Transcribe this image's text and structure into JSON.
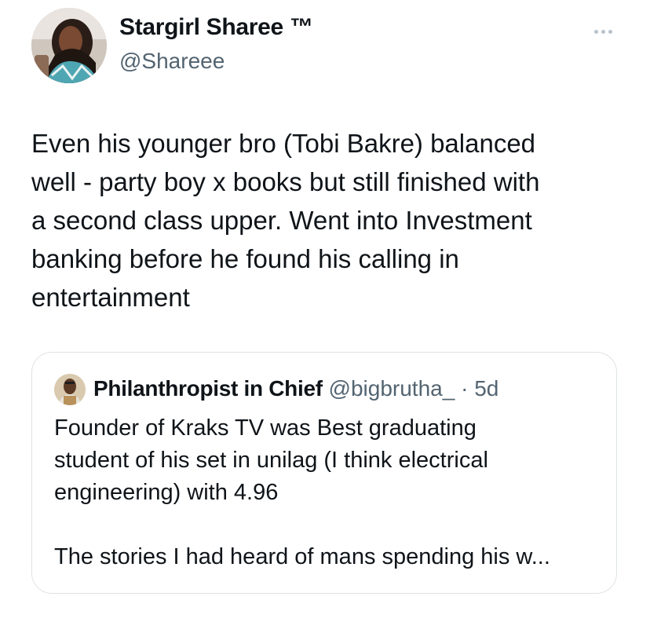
{
  "author": {
    "name": "Stargirl Sharee ™",
    "handle": "@Shareee"
  },
  "tweet": {
    "lines": [
      "Even his younger bro (Tobi Bakre) balanced",
      "well - party boy x books but still finished with",
      "a second class upper. Went into Investment",
      "banking before he found his calling in",
      "entertainment"
    ]
  },
  "quoted_tweet": {
    "name": "Philanthropist in Chief",
    "handle": "@bigbrutha_",
    "separator": "·",
    "time": "5d",
    "lines": [
      "Founder of Kraks TV was Best graduating",
      "student of his set in unilag (I think electrical",
      "engineering) with 4.96"
    ],
    "lines_after_gap": [
      "The stories I had heard of mans spending his w..."
    ]
  },
  "icons": {
    "more": "more-horizontal-icon"
  }
}
